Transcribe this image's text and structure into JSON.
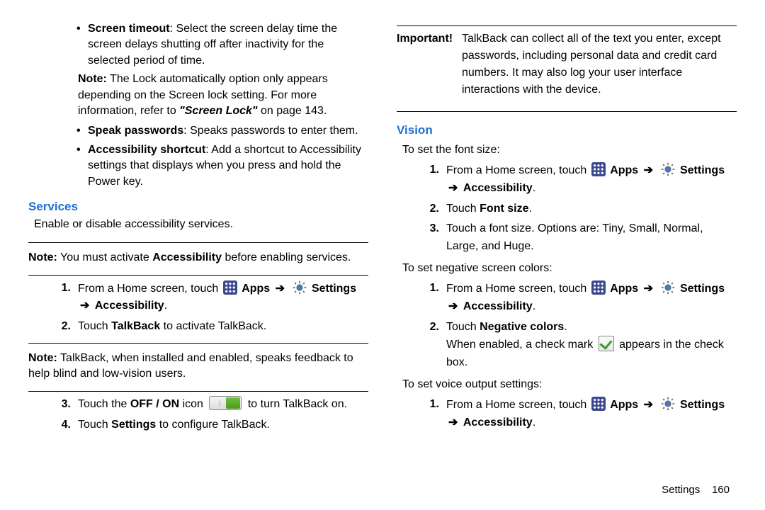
{
  "left": {
    "bullets": [
      {
        "label": "Screen timeout",
        "text": ": Select the screen delay time the screen delays shutting off after inactivity for the selected period of time."
      },
      {
        "note_prefix": "Note:",
        "note_text": "The Lock automatically option only appears depending on the Screen lock setting. For more information, refer to ",
        "note_link": "\"Screen Lock\"",
        "note_tail": " on page 143."
      },
      {
        "label": "Speak passwords",
        "text": ": Speaks passwords to enter them."
      },
      {
        "label": "Accessibility shortcut",
        "text": ": Add a shortcut to Accessibility settings that displays when you press and hold the Power key."
      }
    ],
    "services_head": "Services",
    "services_sub": "Enable or disable accessibility services.",
    "note1_pre": "Note:",
    "note1_text": " You must activate ",
    "note1_bold": "Accessibility",
    "note1_tail": " before enabling services.",
    "step1_pre": "From a Home screen, touch ",
    "apps_label": "Apps",
    "settings_label": "Settings",
    "acc_label": "Accessibility",
    "arrow": "➔",
    "step2_pre": "Touch ",
    "step2_bold": "TalkBack",
    "step2_tail": " to activate TalkBack.",
    "note2_pre": "Note:",
    "note2_text": " TalkBack, when installed and enabled, speaks feedback to help blind and low-vision users.",
    "step3_pre": "Touch the ",
    "step3_bold": "OFF / ON",
    "step3_mid": " icon ",
    "step3_tail": " to turn TalkBack on.",
    "step4_pre": "Touch ",
    "step4_bold": "Settings",
    "step4_tail": " to configure TalkBack."
  },
  "right": {
    "imp_label": "Important!",
    "imp_text": "TalkBack can collect all of the text you enter, except passwords, including personal data and credit card numbers. It may also log your user interface interactions with the device.",
    "vision_head": "Vision",
    "fontsize_intro": "To set the font size:",
    "step1_pre": "From a Home screen, touch ",
    "apps_label": "Apps",
    "settings_label": "Settings",
    "acc_label": "Accessibility",
    "arrow": "➔",
    "step2_pre": "Touch ",
    "step2_bold": "Font size",
    "step2_tail": ".",
    "step3_text": "Touch a font size. Options are: Tiny, Small, Normal, Large, and Huge.",
    "neg_intro": "To set negative screen colors:",
    "neg_step2_pre": "Touch ",
    "neg_step2_bold": "Negative colors",
    "neg_step2_tail": ".",
    "neg_checked_pre": "When enabled, a check mark ",
    "neg_checked_tail": " appears in the check box.",
    "voice_intro": "To set voice output settings:"
  },
  "footer": {
    "label": "Settings",
    "page": "160"
  }
}
